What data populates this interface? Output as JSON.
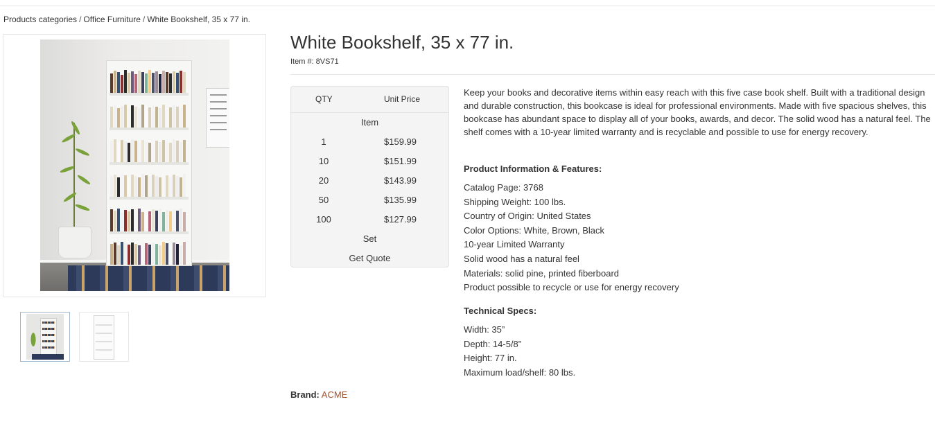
{
  "breadcrumb": {
    "items": [
      "Products categories",
      "Office Furniture",
      "White Bookshelf, 35 x 77 in."
    ],
    "separator": "/"
  },
  "product": {
    "title": "White Bookshelf, 35 x 77 in.",
    "item_number": "Item #: 8VS71",
    "brand_label": "Brand:",
    "brand_name": "ACME",
    "brand_color": "#a0522d"
  },
  "pricing": {
    "qty_header": "QTY",
    "unit_price_header": "Unit Price",
    "group_label": "Item",
    "rows": [
      {
        "qty": "1",
        "price": "$159.99"
      },
      {
        "qty": "10",
        "price": "$151.99"
      },
      {
        "qty": "20",
        "price": "$143.99"
      },
      {
        "qty": "50",
        "price": "$135.99"
      },
      {
        "qty": "100",
        "price": "$127.99"
      }
    ],
    "set_label": "Set",
    "quote_label": "Get Quote"
  },
  "description": "Keep your books and decorative items within easy reach with this five case book shelf. Built with a traditional design and durable construction, this bookcase is ideal for professional environments. Made with five spacious shelves, this bookcase has abundant space to display all of your books, awards, and decor. The solid wood has a natural feel. The shelf comes with a 10-year limited warranty and is recyclable and possible to use for energy recovery.",
  "features": {
    "title": "Product Information & Features:",
    "items": [
      "Catalog Page: 3768",
      "Shipping Weight: 100 lbs.",
      "Country of Origin: United States",
      "Color Options: White, Brown, Black",
      "10-year Limited Warranty",
      "Solid wood has a natural feel",
      "Materials: solid pine, printed fiberboard",
      "Product possible to recycle or use for energy recovery"
    ]
  },
  "specs": {
    "title": "Technical Specs:",
    "items": [
      "Width: 35”",
      "Depth: 14-5/8”",
      "Height: 77 in.",
      "Maximum load/shelf: 80 lbs."
    ]
  },
  "gallery": {
    "thumbnails": [
      "styled-room-photo",
      "plain-white-shelf-photo"
    ],
    "selected_index": 0
  }
}
